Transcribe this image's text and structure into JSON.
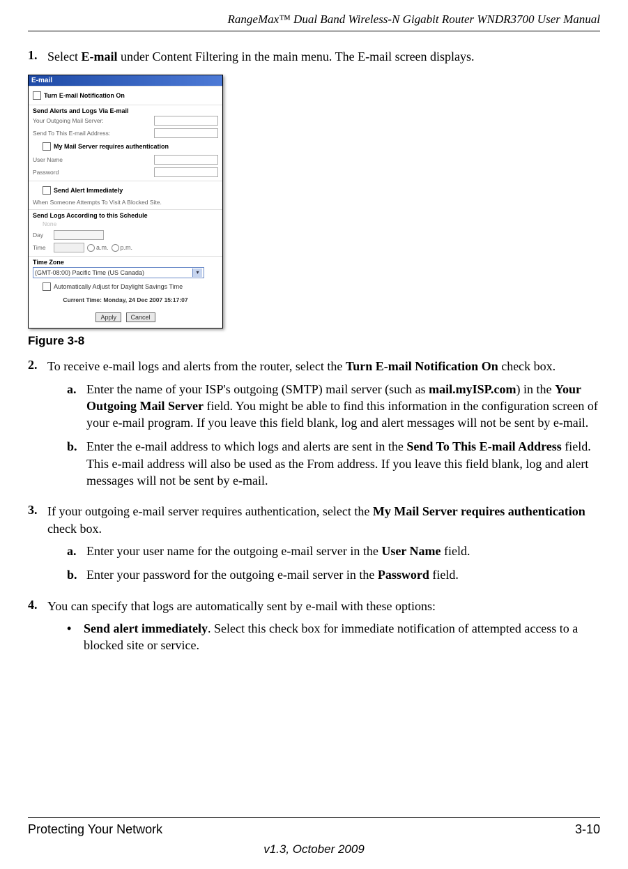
{
  "header": {
    "title": "RangeMax™ Dual Band Wireless-N Gigabit Router WNDR3700 User Manual"
  },
  "step1": {
    "num": "1.",
    "prefix": "Select ",
    "bold": "E-mail",
    "suffix": " under Content Filtering in the main menu. The E-mail screen displays."
  },
  "screenshot": {
    "title": "E-mail",
    "notify_label": "Turn E-mail Notification On",
    "section_alerts": "Send Alerts and Logs Via E-mail",
    "outgoing_label": "Your Outgoing Mail Server:",
    "sendto_label": "Send To This E-mail Address:",
    "auth_label": "My Mail Server requires authentication",
    "user_label": "User Name",
    "pass_label": "Password",
    "section_immediate": "Send Alert Immediately",
    "immediate_text": "When Someone Attempts To Visit A Blocked Site.",
    "section_schedule": "Send Logs According to this Schedule",
    "sched_none": "None",
    "sched_day": "Day",
    "sched_time": "Time",
    "am": "a.m.",
    "pm": "p.m.",
    "section_tz": "Time Zone",
    "tz_value": "(GMT-08:00) Pacific Time (US Canada)",
    "dst_label": "Automatically Adjust for Daylight Savings Time",
    "current_time": "Current Time:   Monday, 24 Dec 2007 15:17:07",
    "apply": "Apply",
    "cancel": "Cancel"
  },
  "figure_caption": "Figure 3-8",
  "step2": {
    "num": "2.",
    "text_prefix": "To receive e-mail logs and alerts from the router, select the ",
    "text_bold": "Turn E-mail Notification On",
    "text_suffix": " check box.",
    "a": {
      "num": "a.",
      "t1": "Enter the name of your ISP's outgoing (SMTP) mail server (such as ",
      "b1": "mail.myISP.com",
      "t2": ") in the ",
      "b2": "Your Outgoing Mail Server",
      "t3": " field. You might be able to find this information in the configuration screen of your e-mail program. If you leave this field blank, log and alert messages will not be sent by e-mail."
    },
    "b": {
      "num": "b.",
      "t1": "Enter the e-mail address to which logs and alerts are sent in the ",
      "b1": "Send To This E-mail Address",
      "t2": " field. This e-mail address will also be used as the From address. If you leave this field blank, log and alert messages will not be sent by e-mail."
    }
  },
  "step3": {
    "num": "3.",
    "t1": "If your outgoing e-mail server requires authentication, select the ",
    "b1": "My Mail Server requires authentication",
    "t2": " check box.",
    "a": {
      "num": "a.",
      "t1": "Enter your user name for the outgoing e-mail server in the ",
      "b1": "User Name",
      "t2": " field."
    },
    "b": {
      "num": "b.",
      "t1": "Enter your password for the outgoing e-mail server in the ",
      "b1": "Password",
      "t2": " field."
    }
  },
  "step4": {
    "num": "4.",
    "text": "You can specify that logs are automatically sent by e-mail with these options:",
    "bullet": {
      "mark": "•",
      "b1": "Send alert immediately",
      "t1": ". Select this check box for immediate notification of attempted access to a blocked site or service."
    }
  },
  "footer": {
    "left": "Protecting Your Network",
    "right": "3-10",
    "version": "v1.3, October 2009"
  }
}
